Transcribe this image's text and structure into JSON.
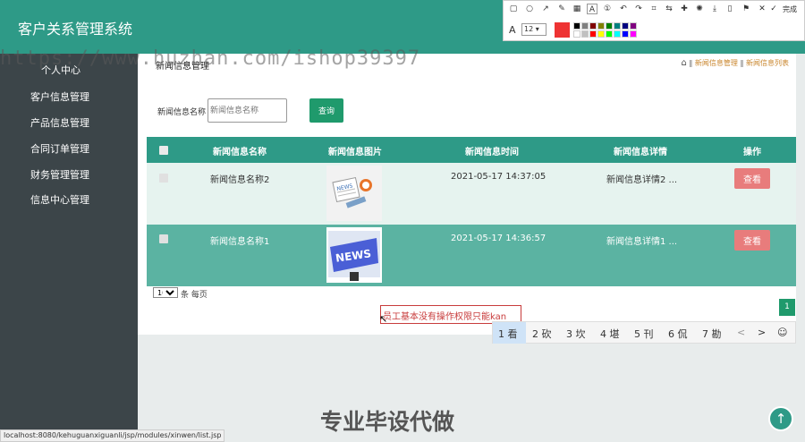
{
  "app": {
    "title": "客户关系管理系统"
  },
  "header": {
    "icons": [
      "fullscreen-icon",
      "user-icon"
    ]
  },
  "sidebar": {
    "items": [
      {
        "label": "个人中心"
      },
      {
        "label": "客户信息管理"
      },
      {
        "label": "产品信息管理"
      },
      {
        "label": "合同订单管理"
      },
      {
        "label": "财务管理管理"
      },
      {
        "label": "信息中心管理"
      }
    ]
  },
  "page": {
    "title": "新闻信息管理",
    "breadcrumb": [
      "新闻信息管理",
      "新闻信息列表"
    ],
    "breadcrumb_sep": "‖"
  },
  "search": {
    "label": "新闻信息名称",
    "placeholder": "新闻信息名称",
    "button": "查询"
  },
  "table": {
    "columns": [
      "新闻信息名称",
      "新闻信息图片",
      "新闻信息时间",
      "新闻信息详情",
      "操作"
    ],
    "rows": [
      {
        "name": "新闻信息名称2",
        "time": "2021-05-17 14:37:05",
        "detail": "新闻信息详情2 ...",
        "action": "查看",
        "image": "NEWS"
      },
      {
        "name": "新闻信息名称1",
        "time": "2021-05-17 14:36:57",
        "detail": "新闻信息详情1 ...",
        "action": "查看",
        "image": "NEWS"
      }
    ]
  },
  "pagination": {
    "page_size": "10",
    "page_size_label": "条 每页",
    "current_page": "1"
  },
  "annotation": {
    "text": "员工基本没有操作权限只能kan"
  },
  "ime": {
    "candidates": [
      "1 看",
      "2 砍",
      "3 坎",
      "4 堪",
      "5 刊",
      "6 侃",
      "7 勘"
    ],
    "nav_prev": "<",
    "nav_next": ">",
    "emoji": "☺"
  },
  "toolbar": {
    "done_label": "完成",
    "font_size": "12",
    "font_label": "A",
    "colors": {
      "current": "#ee3333",
      "swatches": [
        "#000000",
        "#808080",
        "#800000",
        "#808000",
        "#008000",
        "#008080",
        "#000080",
        "#800080",
        "#ffffff",
        "#c0c0c0",
        "#ff0000",
        "#ffff00",
        "#00ff00",
        "#00ffff",
        "#0000ff",
        "#ff00ff"
      ]
    }
  },
  "overlay": {
    "watermark": "https://www.huzhan.com/ishop39397",
    "big_text": "专业毕设代做",
    "status_url": "localhost:8080/kehuguanxiguanli/jsp/modules/xinwen/list.jsp"
  },
  "colors": {
    "primary": "#2e9a87",
    "sidebar": "#3c4549",
    "accent_button": "#1f9a6c",
    "view_button": "#e87c7c",
    "row_alt": "#5bb3a2"
  }
}
